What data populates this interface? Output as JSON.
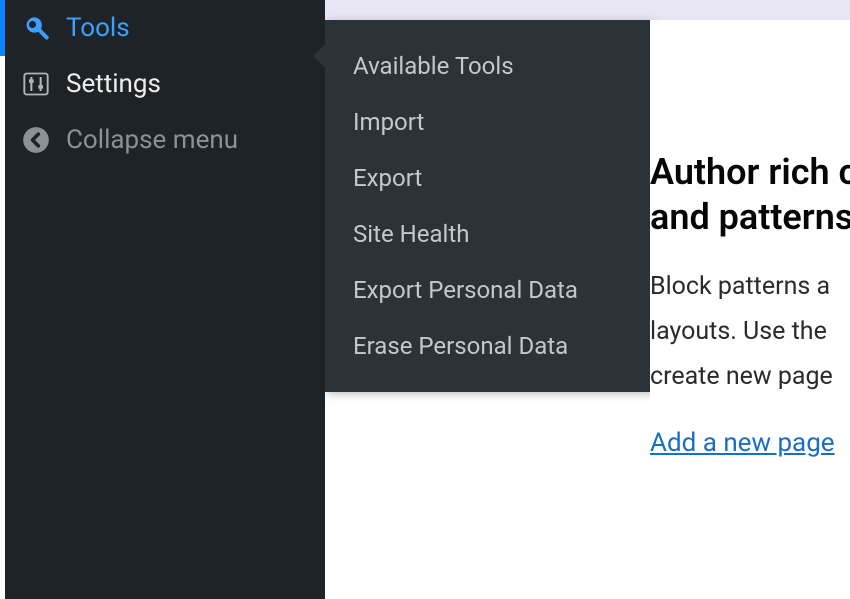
{
  "sidebar": {
    "items": [
      {
        "label": "Tools",
        "icon": "wrench-icon"
      },
      {
        "label": "Settings",
        "icon": "sliders-icon"
      },
      {
        "label": "Collapse menu",
        "icon": "collapse-icon"
      }
    ]
  },
  "submenu": {
    "items": [
      {
        "label": "Available Tools"
      },
      {
        "label": "Import"
      },
      {
        "label": "Export"
      },
      {
        "label": "Site Health"
      },
      {
        "label": "Export Personal Data"
      },
      {
        "label": "Erase Personal Data"
      }
    ]
  },
  "main": {
    "heading_line1": "Author rich c",
    "heading_line2": "and patterns",
    "body_line1": "Block patterns a",
    "body_line2": "layouts. Use the",
    "body_line3": "create new page",
    "link_text": "Add a new page"
  }
}
